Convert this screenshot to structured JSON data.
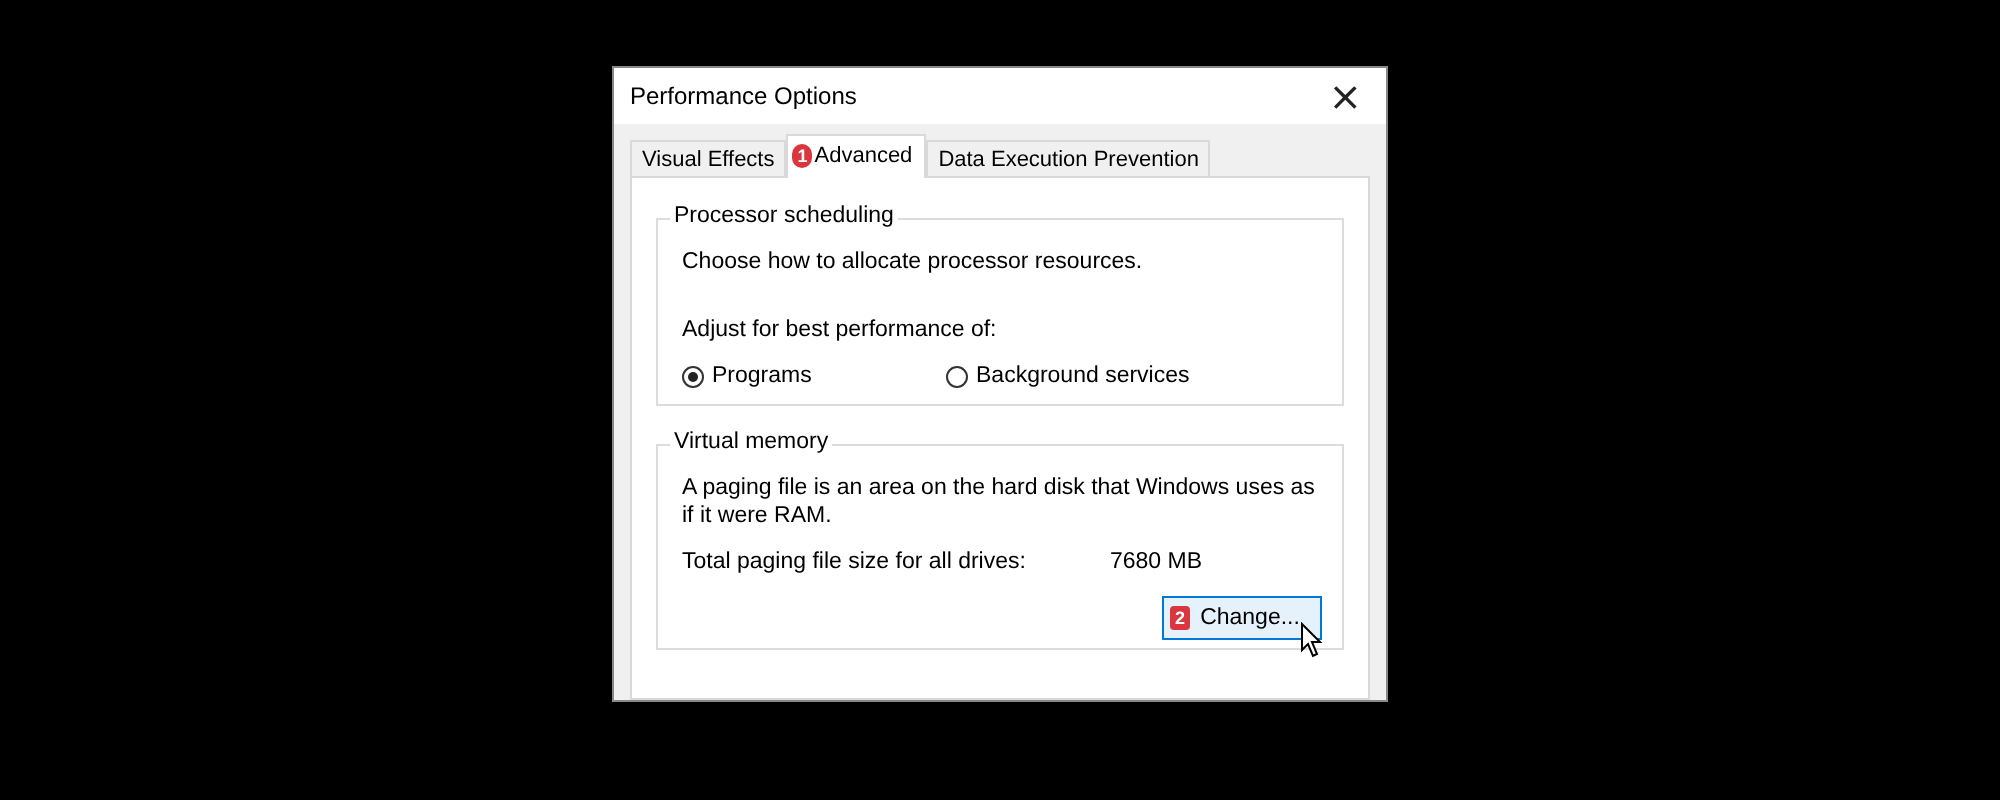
{
  "window": {
    "title": "Performance Options",
    "close": "×"
  },
  "tabs": [
    {
      "label": "Visual Effects",
      "selected": false
    },
    {
      "label": "Advanced",
      "selected": true,
      "marker": "1"
    },
    {
      "label": "Data Execution Prevention",
      "selected": false
    }
  ],
  "processor_scheduling": {
    "title": "Processor scheduling",
    "description": "Choose how to allocate processor resources.",
    "prompt": "Adjust for best performance of:",
    "options": [
      {
        "label": "Programs",
        "selected": true
      },
      {
        "label": "Background services",
        "selected": false
      }
    ]
  },
  "virtual_memory": {
    "title": "Virtual memory",
    "description": "A paging file is an area on the hard disk that Windows uses as if it were RAM.",
    "total_label": "Total paging file size for all drives:",
    "total_value": "7680 MB",
    "button": {
      "label": "Change...",
      "marker": "2",
      "hovered": true
    }
  }
}
